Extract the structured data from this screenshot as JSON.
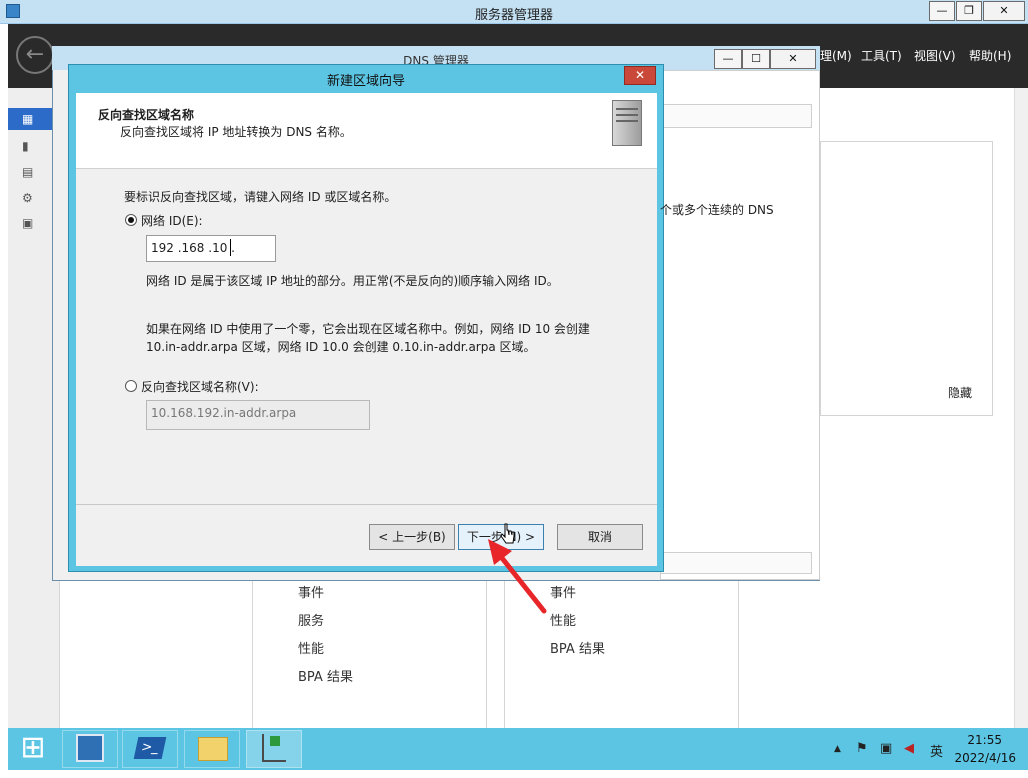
{
  "outer": {
    "title": "服务器管理器",
    "minimize": "—",
    "restore": "❐",
    "close": "✕",
    "back_glyph": "←",
    "menus": [
      "理(M)",
      "工具(T)",
      "视图(V)",
      "帮助(H)"
    ],
    "nav_icons": [
      "▦",
      "▮",
      "▤",
      "⚙",
      "▣"
    ]
  },
  "dns_manager": {
    "title": "DNS 管理器",
    "minimize": "—",
    "maximize": "☐",
    "close": "✕",
    "text_fragment": "个或多个连续的 DNS",
    "hide_label": "隐藏"
  },
  "wizard": {
    "title": "新建区域向导",
    "close": "✕",
    "heading": "反向查找区域名称",
    "subheading": "反向查找区域将 IP 地址转换为 DNS 名称。",
    "instruction": "要标识反向查找区域，请键入网络 ID 或区域名称。",
    "option_network_id": "网络 ID(E):",
    "network_id_value": "192  .168  .10   .",
    "network_id_help": "网络 ID 是属于该区域 IP 地址的部分。用正常(不是反向的)顺序输入网络 ID。",
    "zero_note_line1": "如果在网络 ID 中使用了一个零，它会出现在区域名称中。例如，网络 ID 10 会创建",
    "zero_note_line2": "10.in-addr.arpa 区域，网络 ID 10.0 会创建 0.10.in-addr.arpa 区域。",
    "option_zone_name": "反向查找区域名称(V):",
    "zone_name_value": "10.168.192.in-addr.arpa",
    "back_button": "< 上一步(B)",
    "next_button": "下一步(N) >",
    "cancel_button": "取消"
  },
  "bottom_lists": {
    "col1": [
      "事件",
      "服务",
      "性能",
      "BPA 结果"
    ],
    "col2": [
      "事件",
      "性能",
      "BPA 结果"
    ]
  },
  "taskbar": {
    "start_glyph": "⊞",
    "time": "21:55",
    "date": "2022/4/16",
    "tray_chevron": "▲",
    "tray_flag": "⚑",
    "tray_network": "▣",
    "tray_sound": "◀",
    "ime": "英"
  },
  "colors": {
    "accent": "#5cc5e3",
    "close_red": "#c9483a",
    "annotation_arrow": "#e8262a"
  }
}
